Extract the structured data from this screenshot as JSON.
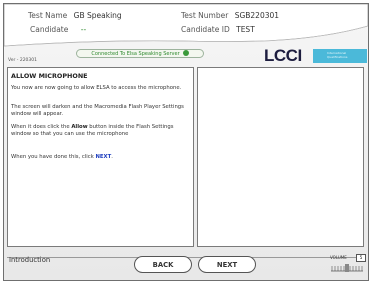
{
  "header": {
    "test_name_label": "Test Name",
    "test_name_value": "GB Speaking",
    "test_number_label": "Test Number",
    "test_number_value": "SGB220301",
    "candidate_label": "Candidate",
    "candidate_value": "--",
    "candidate_id_label": "Candidate ID",
    "candidate_id_value": "TEST",
    "connection_status": "Connected To Elsa Speaking Server",
    "version": "Ver - 220301"
  },
  "logo": {
    "text": "LCCI",
    "tag_line1": "International",
    "tag_line2": "Qualifications",
    "brand_color": "#4bb9d9"
  },
  "left_panel": {
    "title": "ALLOW MICROPHONE",
    "para1": "You now are now going to allow ELSA to access the microphone.",
    "para2": "The screen will darken and the Macromedia Flash Player Settings window will appear.",
    "para3_a": "When it does click the ",
    "para3_b": "Allow",
    "para3_c": " button inside the Flash Settings window so that you can use the microphone",
    "para4_a": "When you have done this, click ",
    "para4_b": "NEXT",
    "para4_c": "."
  },
  "footer": {
    "section": "Introduction",
    "back_label": "BACK",
    "next_label": "NEXT",
    "volume_label": "VOLUME",
    "volume_value": "5"
  }
}
